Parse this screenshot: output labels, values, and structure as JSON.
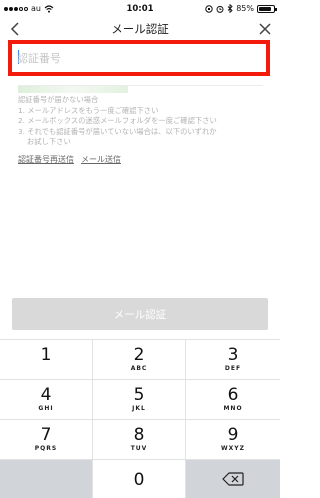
{
  "status_bar": {
    "carrier": "au",
    "time": "10:01",
    "battery_percent": "85%",
    "battery_level": 0.85
  },
  "nav": {
    "title": "メール認証"
  },
  "code_input": {
    "placeholder": "認証番号",
    "value": ""
  },
  "help": {
    "title": "認証番号が届かない場合",
    "lines": [
      "1. メールアドレスをもう一度ご確認下さい",
      "2. メールボックスの迷惑メールフォルダを一度ご確認下さい",
      "3. それでも認証番号が届いていない場合は、以下のいずれか",
      "お試し下さい"
    ]
  },
  "links": {
    "resend_code": "認証番号再送信",
    "send_mail": "メール送信"
  },
  "submit": {
    "label": "メール認証"
  },
  "keypad": {
    "keys": [
      {
        "num": "1",
        "sub": ""
      },
      {
        "num": "2",
        "sub": "ABC"
      },
      {
        "num": "3",
        "sub": "DEF"
      },
      {
        "num": "4",
        "sub": "GHI"
      },
      {
        "num": "5",
        "sub": "JKL"
      },
      {
        "num": "6",
        "sub": "MNO"
      },
      {
        "num": "7",
        "sub": "PQRS"
      },
      {
        "num": "8",
        "sub": "TUV"
      },
      {
        "num": "9",
        "sub": "WXYZ"
      },
      {
        "num": "0",
        "sub": ""
      }
    ]
  },
  "colors": {
    "highlight_border": "#f21b0c",
    "submit_disabled": "#d9d9d9",
    "help_text": "#b3b3b3"
  }
}
